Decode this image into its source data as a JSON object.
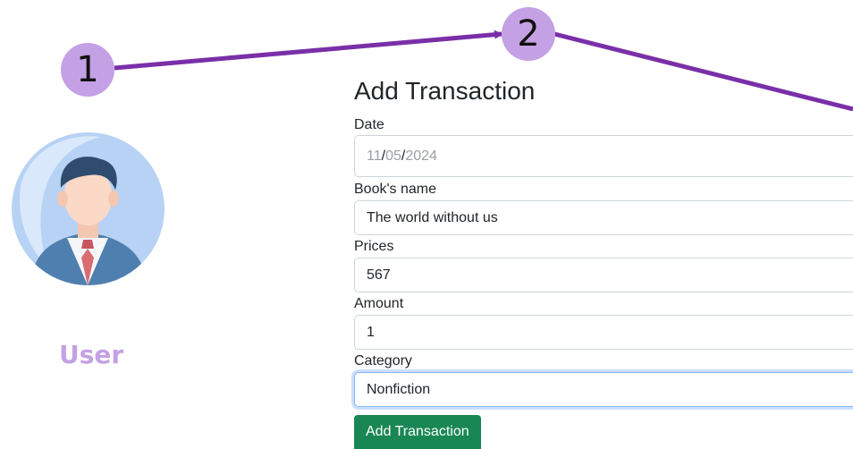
{
  "annotations": {
    "step_1": "1",
    "step_2": "2",
    "color": "#c4a0e4",
    "arrow_color": "#7a2fa8"
  },
  "user_panel": {
    "avatar_icon": "businessman-avatar-icon",
    "label": "User"
  },
  "form": {
    "title": "Add Transaction",
    "date": {
      "label": "Date",
      "month": "11",
      "day": "05",
      "year": "2024",
      "sep": "/"
    },
    "book_name": {
      "label": "Book's name",
      "value": "The world without us"
    },
    "prices": {
      "label": "Prices",
      "value": "567"
    },
    "amount": {
      "label": "Amount",
      "value": "1"
    },
    "category": {
      "label": "Category",
      "value": "Nonfiction"
    },
    "submit_label": "Add Transaction",
    "submit_color": "#198754"
  }
}
